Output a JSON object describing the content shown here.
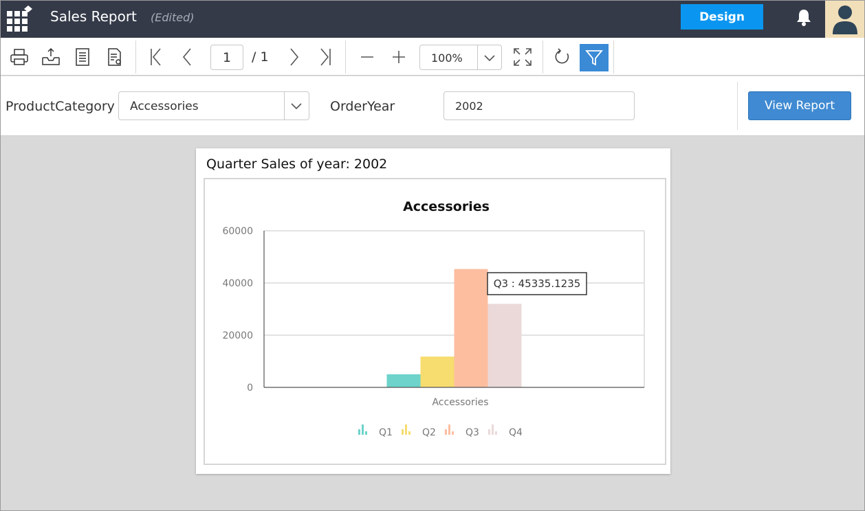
{
  "header": {
    "title": "Sales Report",
    "status": "(Edited)",
    "design_label": "Design"
  },
  "toolbar": {
    "page_current": "1",
    "page_total": "/ 1",
    "zoom": "100%"
  },
  "parameters": {
    "category_label": "ProductCategory",
    "category_value": "Accessories",
    "year_label": "OrderYear",
    "year_value": "2002",
    "view_report_label": "View Report"
  },
  "report": {
    "title": "Quarter Sales of year: 2002"
  },
  "colors": {
    "header_bg": "#343a48",
    "design_button": "#0a96f0",
    "accent_blue": "#3f8ad2"
  },
  "chart_data": {
    "type": "bar",
    "title": "Accessories",
    "categories": [
      "Accessories"
    ],
    "series": [
      {
        "name": "Q1",
        "values": [
          5000
        ],
        "color": "#6dd3cb"
      },
      {
        "name": "Q2",
        "values": [
          11800
        ],
        "color": "#f7dc6f"
      },
      {
        "name": "Q3",
        "values": [
          45335.1235
        ],
        "color": "#fdbea0"
      },
      {
        "name": "Q4",
        "values": [
          32000
        ],
        "color": "#ebd9d9"
      }
    ],
    "ylim": [
      0,
      60000
    ],
    "yticks": [
      "0",
      "20000",
      "40000",
      "60000"
    ],
    "grid": true,
    "legend_position": "bottom",
    "tooltip": "Q3 : 45335.1235"
  }
}
